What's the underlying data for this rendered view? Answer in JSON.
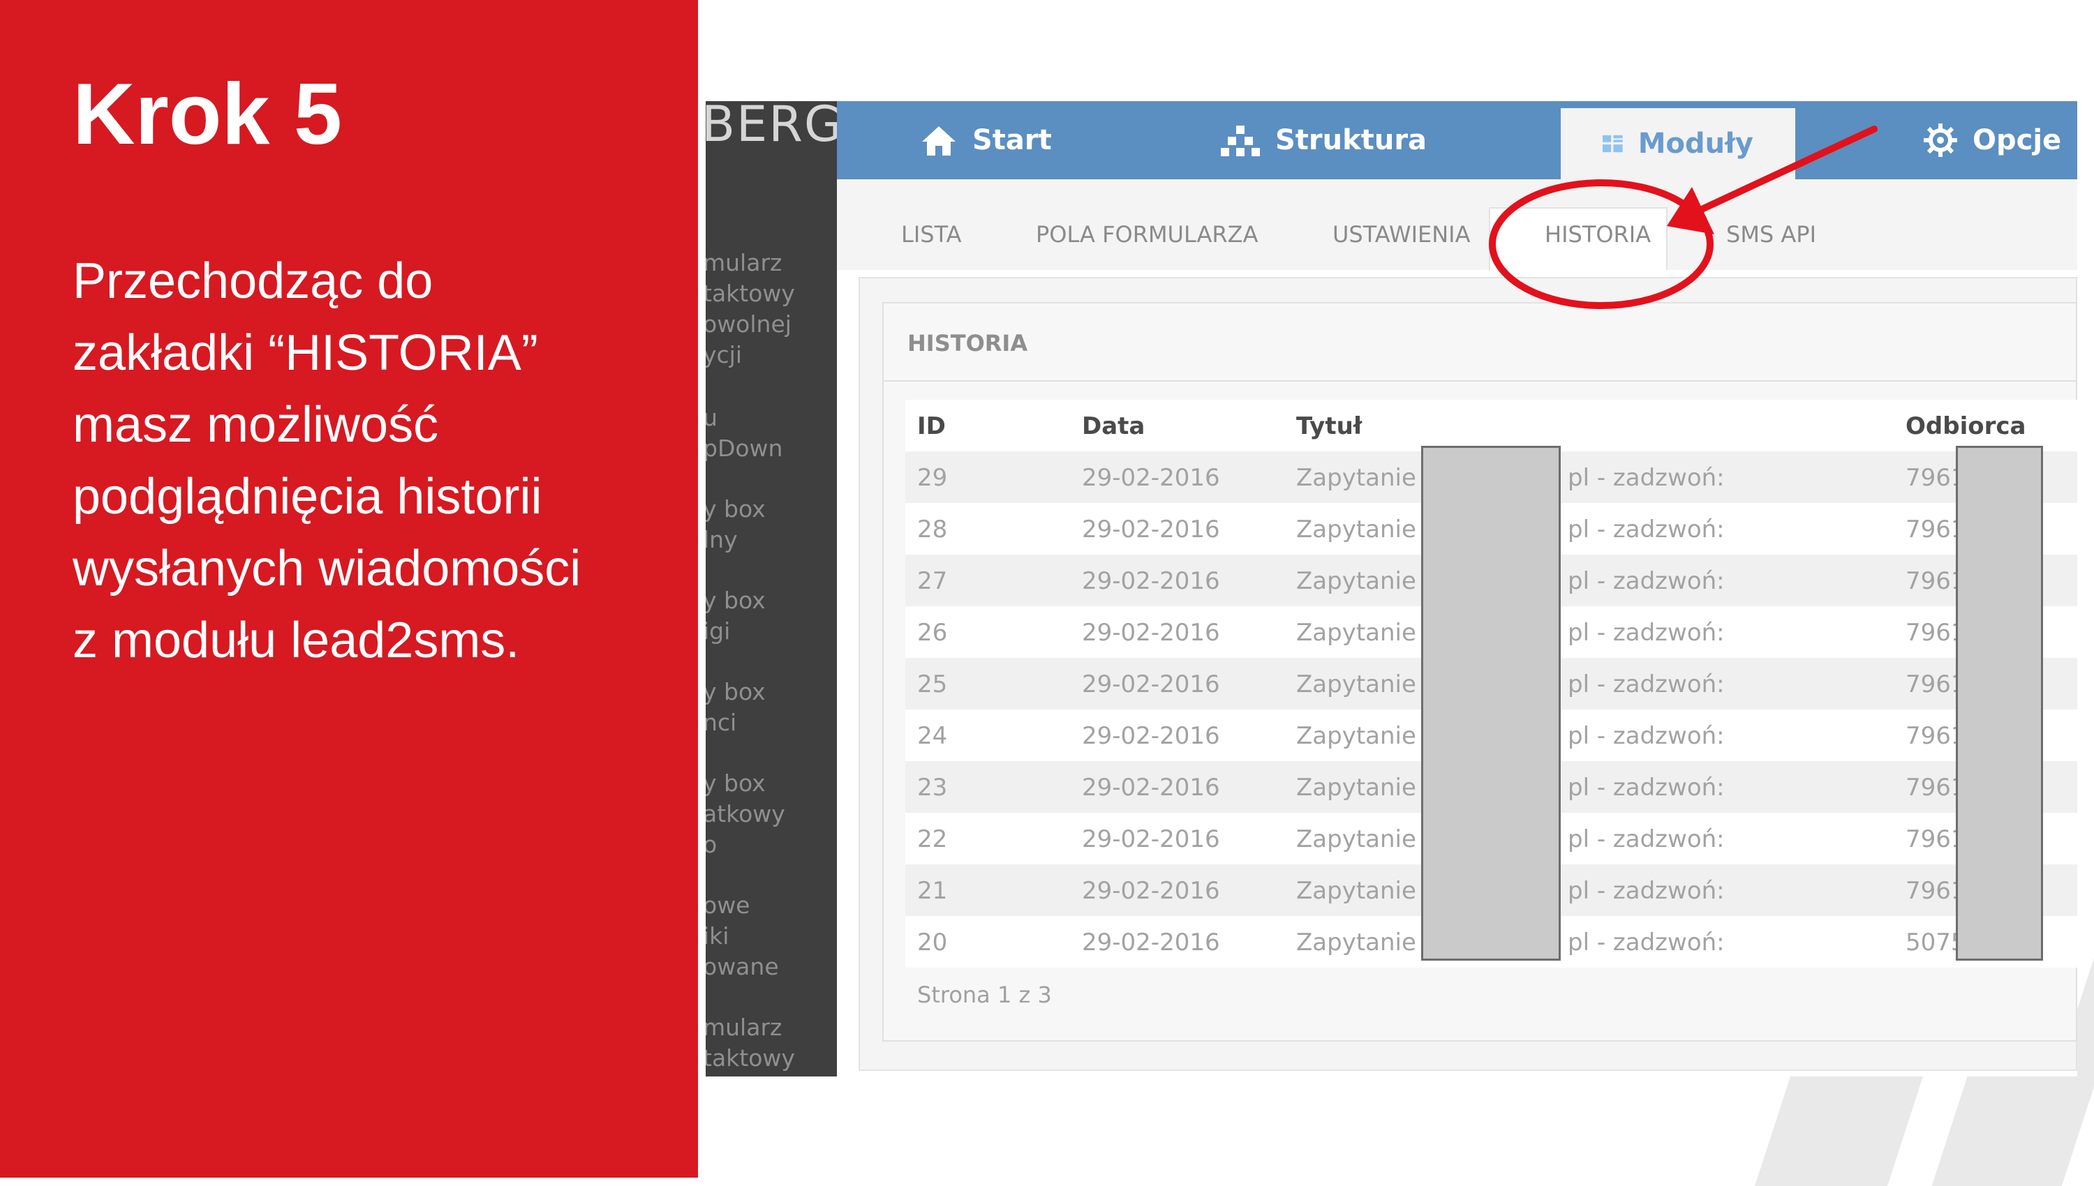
{
  "slide": {
    "title": "Krok 5",
    "body_lines": [
      "Przechodząc do",
      "zakładki “HISTORIA”",
      "masz możliwość",
      "podglądnięcia historii",
      "wysłanych wiadomości",
      "z modułu lead2sms."
    ]
  },
  "app": {
    "logo": "BERG",
    "sidebar": [
      [
        "mularz",
        "taktowy",
        "owolnej",
        "ycji"
      ],
      [
        "u",
        "pDown"
      ],
      [
        "y box",
        "lny"
      ],
      [
        "y box",
        "igi"
      ],
      [
        "y box",
        "nci"
      ],
      [
        "y box",
        "atkowy",
        "o"
      ],
      [
        "owe",
        "iki",
        "owane"
      ],
      [
        "mularz",
        "taktowy"
      ]
    ],
    "nav": {
      "start": "Start",
      "struktura": "Struktura",
      "moduly": "Moduły",
      "opcje": "Opcje",
      "active": "Moduły"
    },
    "subtabs": {
      "lista": "LISTA",
      "pola": "POLA FORMULARZA",
      "ustawienia": "USTAWIENIA",
      "historia": "HISTORIA",
      "smsapi": "SMS API",
      "active": "HISTORIA"
    },
    "panel_title": "HISTORIA",
    "table": {
      "headers": [
        "ID",
        "Data",
        "Tytuł",
        "Odbiorca"
      ],
      "rows": [
        {
          "id": "29",
          "date": "29-02-2016",
          "title": "Zapytanie z",
          "title_end": "pl - zadzwoń:",
          "recipient": "7961"
        },
        {
          "id": "28",
          "date": "29-02-2016",
          "title": "Zapytanie z",
          "title_end": "pl - zadzwoń:",
          "recipient": "7961"
        },
        {
          "id": "27",
          "date": "29-02-2016",
          "title": "Zapytanie z",
          "title_end": "pl - zadzwoń:",
          "recipient": "7961"
        },
        {
          "id": "26",
          "date": "29-02-2016",
          "title": "Zapytanie z",
          "title_end": "pl - zadzwoń:",
          "recipient": "7961"
        },
        {
          "id": "25",
          "date": "29-02-2016",
          "title": "Zapytanie z",
          "title_end": "pl - zadzwoń:",
          "recipient": "7961"
        },
        {
          "id": "24",
          "date": "29-02-2016",
          "title": "Zapytanie z",
          "title_end": "pl - zadzwoń:",
          "recipient": "7961"
        },
        {
          "id": "23",
          "date": "29-02-2016",
          "title": "Zapytanie z",
          "title_end": "pl - zadzwoń:",
          "recipient": "7961"
        },
        {
          "id": "22",
          "date": "29-02-2016",
          "title": "Zapytanie z",
          "title_end": "pl - zadzwoń:",
          "recipient": "7961"
        },
        {
          "id": "21",
          "date": "29-02-2016",
          "title": "Zapytanie z",
          "title_end": "pl - zadzwoń:",
          "recipient": "7961"
        },
        {
          "id": "20",
          "date": "29-02-2016",
          "title": "Zapytanie z",
          "title_end": "pl - zadzwoń:",
          "recipient": "5075"
        }
      ]
    },
    "pager": "Strona 1 z 3"
  },
  "colors": {
    "brand_red": "#d71921",
    "nav_blue": "#5b8ec1",
    "annotation_red": "#e3111b"
  },
  "icons": [
    "home-icon",
    "sitemap-icon",
    "modules-icon",
    "gear-icon"
  ]
}
